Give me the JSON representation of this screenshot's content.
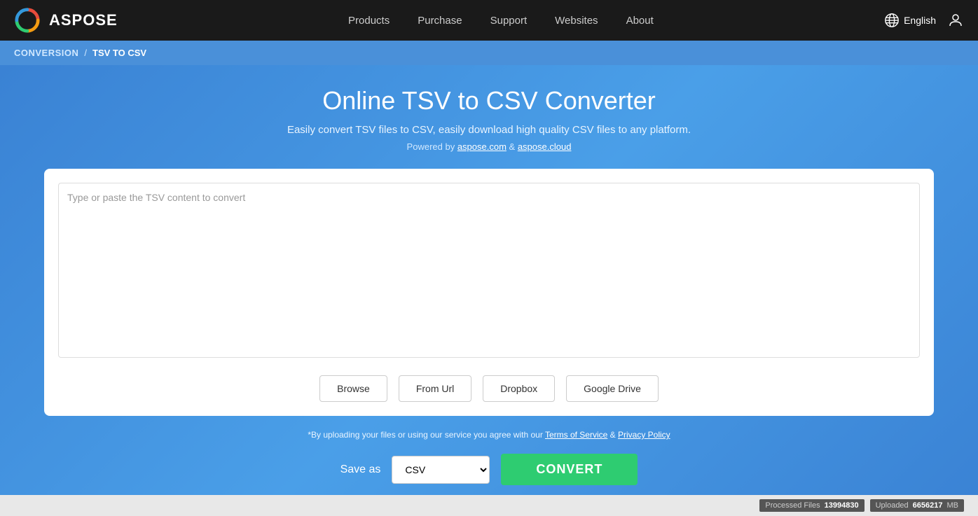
{
  "header": {
    "logo_text": "ASPOSE",
    "nav": [
      {
        "label": "Products",
        "id": "products"
      },
      {
        "label": "Purchase",
        "id": "purchase"
      },
      {
        "label": "Support",
        "id": "support"
      },
      {
        "label": "Websites",
        "id": "websites"
      },
      {
        "label": "About",
        "id": "about"
      }
    ],
    "language": "English",
    "user_icon": "👤"
  },
  "breadcrumb": {
    "conversion_label": "CONVERSION",
    "separator": "/",
    "current": "TSV TO CSV"
  },
  "main": {
    "page_title": "Online TSV to CSV Converter",
    "subtitle": "Easily convert TSV files to CSV, easily download high quality CSV files to any platform.",
    "powered_by_prefix": "Powered by ",
    "powered_by_link1": "aspose.com",
    "powered_by_ampersand": " & ",
    "powered_by_link2": "aspose.cloud",
    "textarea_placeholder": "Type or paste the TSV content to convert",
    "buttons": {
      "browse": "Browse",
      "from_url": "From Url",
      "dropbox": "Dropbox",
      "google_drive": "Google Drive"
    },
    "terms_prefix": "*By uploading your files or using our service you agree with our ",
    "terms_link1": "Terms of Service",
    "terms_ampersand": " & ",
    "terms_link2": "Privacy Policy",
    "save_as_label": "Save as",
    "format_default": "CSV",
    "convert_button": "CONVERT"
  },
  "footer": {
    "processed_label": "Processed Files",
    "processed_value": "13994830",
    "uploaded_label": "Uploaded",
    "uploaded_value": "6656217",
    "uploaded_unit": "MB"
  }
}
